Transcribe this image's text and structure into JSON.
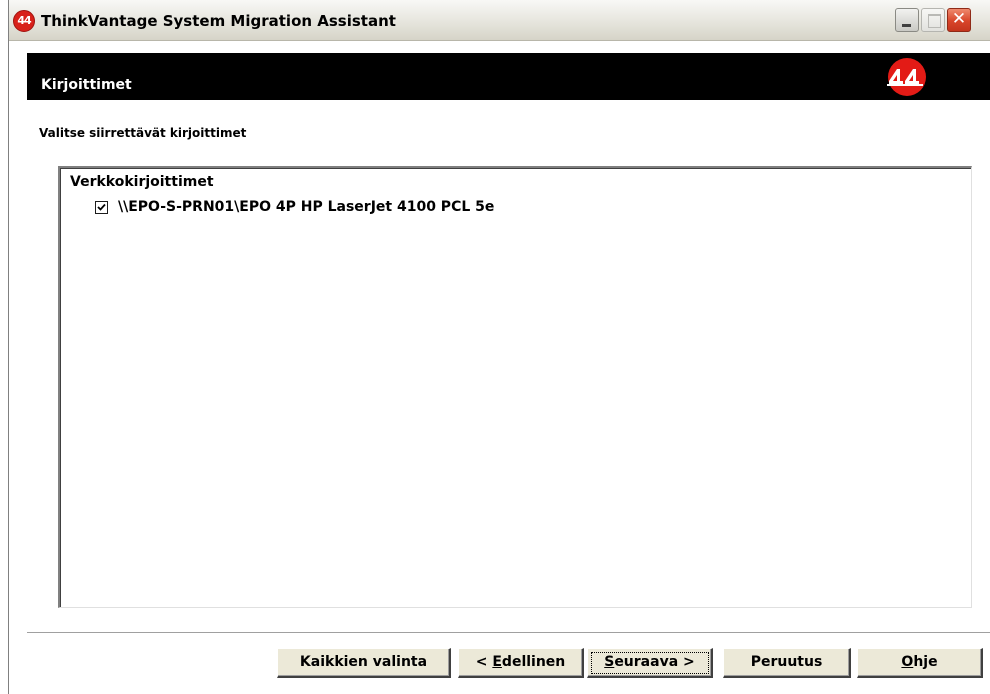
{
  "window": {
    "title": "ThinkVantage System Migration Assistant",
    "icon_name": "sma-app-icon",
    "controls": [
      "minimize-icon",
      "maximize-icon",
      "close-icon"
    ],
    "close_glyph": "✕"
  },
  "header": {
    "heading": "Kirjoittimet",
    "logo_name": "sma-logo-icon",
    "logo_color": "#e31b16"
  },
  "instruction": "Valitse siirrettävät kirjoittimet",
  "printers": {
    "group_label": "Verkkokirjoittimet",
    "items": [
      {
        "label": "\\\\EPO-S-PRN01\\EPO 4P HP LaserJet 4100 PCL 5e",
        "checked": true
      }
    ]
  },
  "buttons": {
    "select_all": "Kaikkien valinta",
    "back_prefix": "< ",
    "back_mnemonic": "E",
    "back_rest": "dellinen",
    "next_mnemonic": "S",
    "next_rest": "euraava >",
    "cancel": "Peruutus",
    "help_mnemonic": "O",
    "help_rest": "hje"
  }
}
